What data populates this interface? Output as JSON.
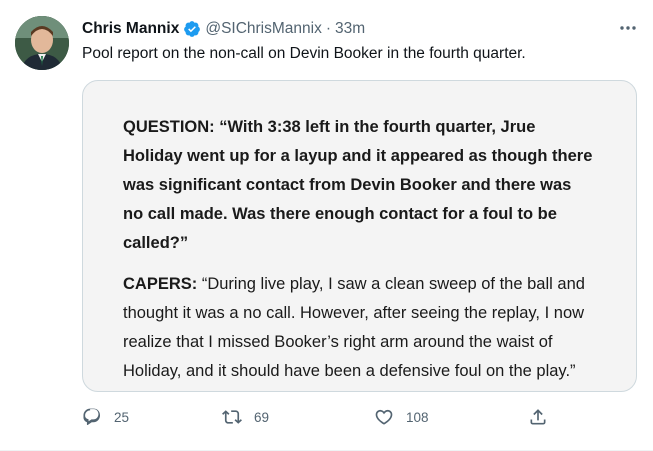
{
  "tweet": {
    "author": {
      "display_name": "Chris Mannix",
      "handle": "@SIChrisMannix",
      "separator": "·",
      "time": "33m",
      "verified": true
    },
    "text": "Pool report on the non-call on Devin Booker in the fourth quarter.",
    "media": {
      "question_lead": "QUESTION:",
      "question_text": " “With 3:38 left in the fourth quarter, Jrue Holiday went up for a layup and it appeared as though there was significant contact from Devin Booker and there was no call made.  Was there enough contact for a foul to be called?”",
      "answer_lead": "CAPERS:",
      "answer_text": " “During live play, I saw a clean sweep of the ball and thought it was a no call.  However, after seeing the replay, I now realize that I missed Booker’s right arm around the waist of Holiday, and it should have been a defensive foul on the play.”"
    },
    "actions": {
      "replies": "25",
      "retweets": "69",
      "likes": "108"
    }
  },
  "colors": {
    "verified_blue": "#1d9bf0",
    "muted_text": "#536471",
    "border": "#cfd9de"
  },
  "icons": [
    "verified-badge-icon",
    "more-icon",
    "reply-icon",
    "retweet-icon",
    "like-icon",
    "share-icon"
  ]
}
